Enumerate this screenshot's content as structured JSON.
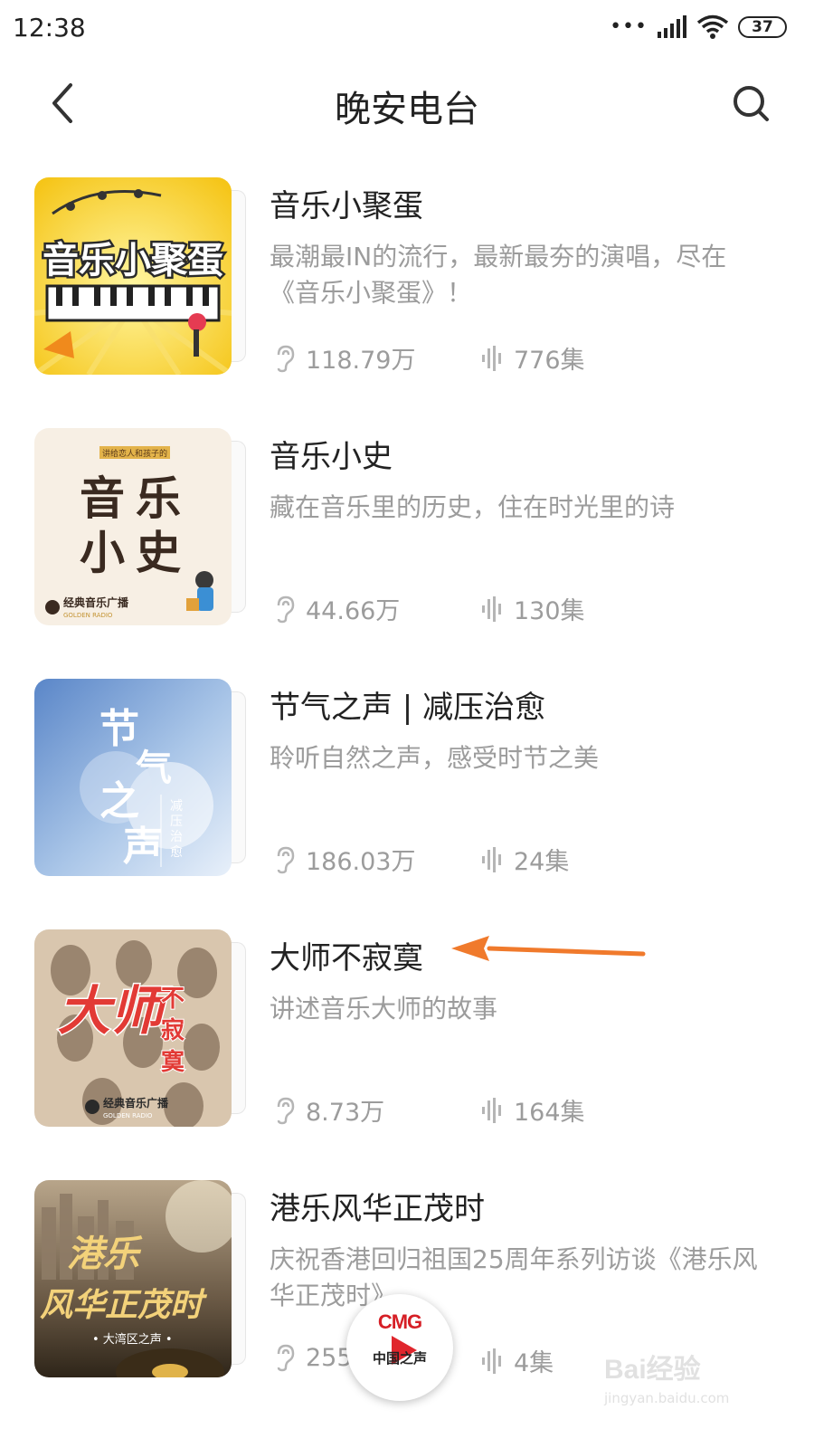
{
  "status_bar": {
    "time": "12:38",
    "battery": "37"
  },
  "header": {
    "title": "晚安电台"
  },
  "items": [
    {
      "title": "音乐小聚蛋",
      "desc": "最潮最IN的流行，最新最夯的演唱，尽在《音乐小聚蛋》！",
      "plays": "118.79万",
      "episodes": "776集",
      "cover_text": "音乐小聚蛋"
    },
    {
      "title": "音乐小史",
      "desc": "藏在音乐里的历史，住在时光里的诗",
      "plays": "44.66万",
      "episodes": "130集",
      "cover_text": "音乐小史",
      "cover_tag": "讲给恋人和孩子的",
      "cover_brand": "经典音乐广播",
      "cover_brand_en": "GOLDEN RADIO"
    },
    {
      "title": "节气之声 | 减压治愈",
      "desc": "聆听自然之声，感受时节之美",
      "plays": "186.03万",
      "episodes": "24集",
      "cover_text": "节气之声",
      "cover_sub": "减压治愈"
    },
    {
      "title": "大师不寂寞",
      "desc": "讲述音乐大师的故事",
      "plays": "8.73万",
      "episodes": "164集",
      "cover_text": "大师",
      "cover_sub": "不寂寞",
      "cover_brand": "经典音乐广播",
      "cover_brand_en": "GOLDEN RADIO"
    },
    {
      "title": "港乐风华正茂时",
      "desc": "庆祝香港回归祖国25周年系列访谈《港乐风华正茂时》",
      "plays": "255",
      "episodes": "4集",
      "cover_text": "港乐风华正茂时",
      "cover_sub": "• 大湾区之声 •"
    }
  ],
  "mini_player": {
    "brand": "CMG",
    "name": "中国之声"
  },
  "watermark": {
    "text": "Bai经验",
    "url": "jingyan.baidu.com"
  },
  "colors": {
    "arrow": "#f07a2c",
    "muted": "#9c9c9c",
    "title": "#222222"
  }
}
